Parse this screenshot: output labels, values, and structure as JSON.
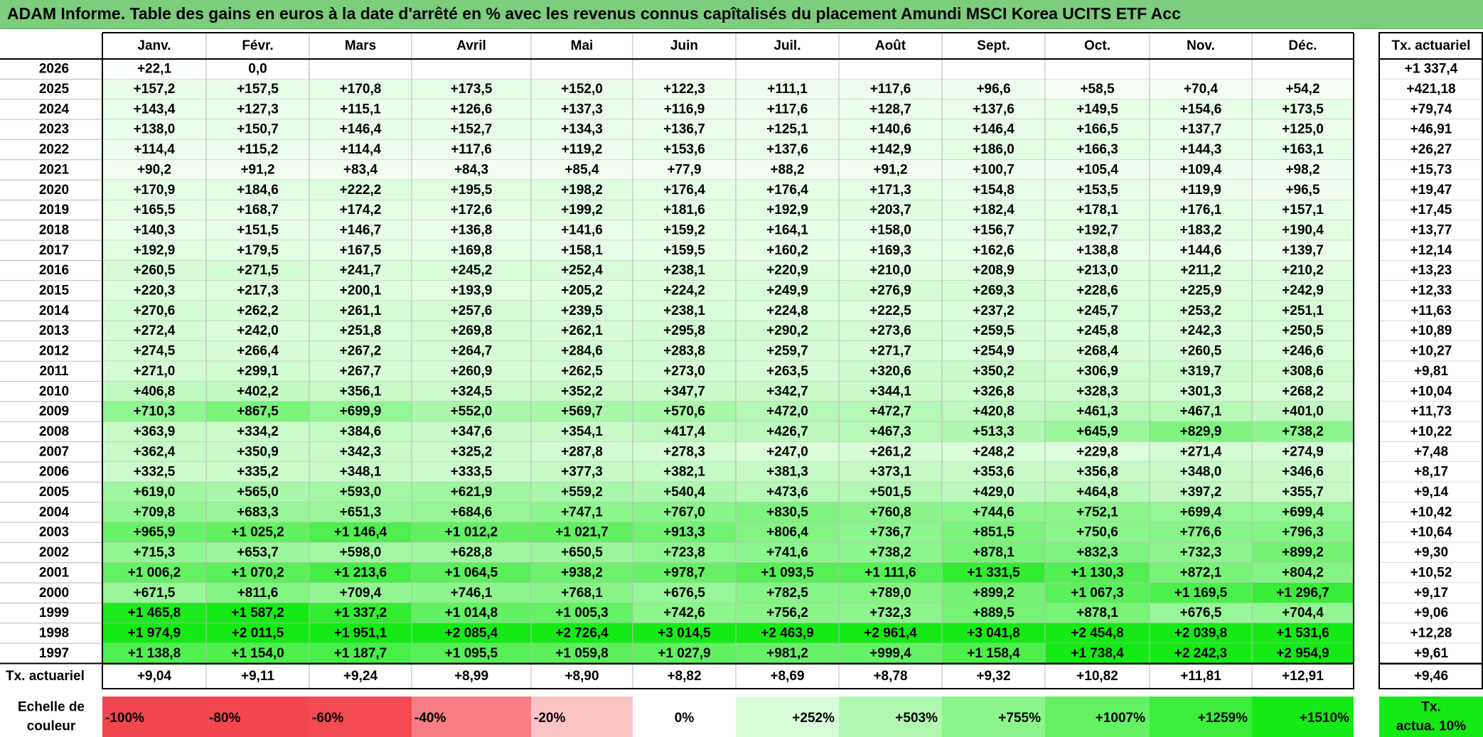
{
  "title": "ADAM Informe. Table des gains en euros à la date d'arrêté en % avec les revenus connus capîtalisés du placement Amundi MSCI Korea UCITS ETF Acc",
  "chart_data": {
    "type": "table",
    "months": [
      "Janv.",
      "Févr.",
      "Mars",
      "Avril",
      "Mai",
      "Juin",
      "Juil.",
      "Août",
      "Sept.",
      "Oct.",
      "Nov.",
      "Déc."
    ],
    "rate_header": "Tx. actuariel",
    "rows": [
      {
        "year": "2026",
        "values": [
          "+22,1",
          "0,0",
          "",
          "",
          "",
          "",
          "",
          "",
          "",
          "",
          "",
          ""
        ],
        "rate": "+1 337,4"
      },
      {
        "year": "2025",
        "values": [
          "+157,2",
          "+157,5",
          "+170,8",
          "+173,5",
          "+152,0",
          "+122,3",
          "+111,1",
          "+117,6",
          "+96,6",
          "+58,5",
          "+70,4",
          "+54,2"
        ],
        "rate": "+421,18"
      },
      {
        "year": "2024",
        "values": [
          "+143,4",
          "+127,3",
          "+115,1",
          "+126,6",
          "+137,3",
          "+116,9",
          "+117,6",
          "+128,7",
          "+137,6",
          "+149,5",
          "+154,6",
          "+173,5"
        ],
        "rate": "+79,74"
      },
      {
        "year": "2023",
        "values": [
          "+138,0",
          "+150,7",
          "+146,4",
          "+152,7",
          "+134,3",
          "+136,7",
          "+125,1",
          "+140,6",
          "+146,4",
          "+166,5",
          "+137,7",
          "+125,0"
        ],
        "rate": "+46,91"
      },
      {
        "year": "2022",
        "values": [
          "+114,4",
          "+115,2",
          "+114,4",
          "+117,6",
          "+119,2",
          "+153,6",
          "+137,6",
          "+142,9",
          "+186,0",
          "+166,3",
          "+144,3",
          "+163,1"
        ],
        "rate": "+26,27"
      },
      {
        "year": "2021",
        "values": [
          "+90,2",
          "+91,2",
          "+83,4",
          "+84,3",
          "+85,4",
          "+77,9",
          "+88,2",
          "+91,2",
          "+100,7",
          "+105,4",
          "+109,4",
          "+98,2"
        ],
        "rate": "+15,73"
      },
      {
        "year": "2020",
        "values": [
          "+170,9",
          "+184,6",
          "+222,2",
          "+195,5",
          "+198,2",
          "+176,4",
          "+176,4",
          "+171,3",
          "+154,8",
          "+153,5",
          "+119,9",
          "+96,5"
        ],
        "rate": "+19,47"
      },
      {
        "year": "2019",
        "values": [
          "+165,5",
          "+168,7",
          "+174,2",
          "+172,6",
          "+199,2",
          "+181,6",
          "+192,9",
          "+203,7",
          "+182,4",
          "+178,1",
          "+176,1",
          "+157,1"
        ],
        "rate": "+17,45"
      },
      {
        "year": "2018",
        "values": [
          "+140,3",
          "+151,5",
          "+146,7",
          "+136,8",
          "+141,6",
          "+159,2",
          "+164,1",
          "+158,0",
          "+156,7",
          "+192,7",
          "+183,2",
          "+190,4"
        ],
        "rate": "+13,77"
      },
      {
        "year": "2017",
        "values": [
          "+192,9",
          "+179,5",
          "+167,5",
          "+169,8",
          "+158,1",
          "+159,5",
          "+160,2",
          "+169,3",
          "+162,6",
          "+138,8",
          "+144,6",
          "+139,7"
        ],
        "rate": "+12,14"
      },
      {
        "year": "2016",
        "values": [
          "+260,5",
          "+271,5",
          "+241,7",
          "+245,2",
          "+252,4",
          "+238,1",
          "+220,9",
          "+210,0",
          "+208,9",
          "+213,0",
          "+211,2",
          "+210,2"
        ],
        "rate": "+13,23"
      },
      {
        "year": "2015",
        "values": [
          "+220,3",
          "+217,3",
          "+200,1",
          "+193,9",
          "+205,2",
          "+224,2",
          "+249,9",
          "+276,9",
          "+269,3",
          "+228,6",
          "+225,9",
          "+242,9"
        ],
        "rate": "+12,33"
      },
      {
        "year": "2014",
        "values": [
          "+270,6",
          "+262,2",
          "+261,1",
          "+257,6",
          "+239,5",
          "+238,1",
          "+224,8",
          "+222,5",
          "+237,2",
          "+245,7",
          "+253,2",
          "+251,1"
        ],
        "rate": "+11,63"
      },
      {
        "year": "2013",
        "values": [
          "+272,4",
          "+242,0",
          "+251,8",
          "+269,8",
          "+262,1",
          "+295,8",
          "+290,2",
          "+273,6",
          "+259,5",
          "+245,8",
          "+242,3",
          "+250,5"
        ],
        "rate": "+10,89"
      },
      {
        "year": "2012",
        "values": [
          "+274,5",
          "+266,4",
          "+267,2",
          "+264,7",
          "+284,6",
          "+283,8",
          "+259,7",
          "+271,7",
          "+254,9",
          "+268,4",
          "+260,5",
          "+246,6"
        ],
        "rate": "+10,27"
      },
      {
        "year": "2011",
        "values": [
          "+271,0",
          "+299,1",
          "+267,7",
          "+260,9",
          "+262,5",
          "+273,0",
          "+263,5",
          "+320,6",
          "+350,2",
          "+306,9",
          "+319,7",
          "+308,6"
        ],
        "rate": "+9,81"
      },
      {
        "year": "2010",
        "values": [
          "+406,8",
          "+402,2",
          "+356,1",
          "+324,5",
          "+352,2",
          "+347,7",
          "+342,7",
          "+344,1",
          "+326,8",
          "+328,3",
          "+301,3",
          "+268,2"
        ],
        "rate": "+10,04"
      },
      {
        "year": "2009",
        "values": [
          "+710,3",
          "+867,5",
          "+699,9",
          "+552,0",
          "+569,7",
          "+570,6",
          "+472,0",
          "+472,7",
          "+420,8",
          "+461,3",
          "+467,1",
          "+401,0"
        ],
        "rate": "+11,73"
      },
      {
        "year": "2008",
        "values": [
          "+363,9",
          "+334,2",
          "+384,6",
          "+347,6",
          "+354,1",
          "+417,4",
          "+426,7",
          "+467,3",
          "+513,3",
          "+645,9",
          "+829,9",
          "+738,2"
        ],
        "rate": "+10,22"
      },
      {
        "year": "2007",
        "values": [
          "+362,4",
          "+350,9",
          "+342,3",
          "+325,2",
          "+287,8",
          "+278,3",
          "+247,0",
          "+261,2",
          "+248,2",
          "+229,8",
          "+271,4",
          "+274,9"
        ],
        "rate": "+7,48"
      },
      {
        "year": "2006",
        "values": [
          "+332,5",
          "+335,2",
          "+348,1",
          "+333,5",
          "+377,3",
          "+382,1",
          "+381,3",
          "+373,1",
          "+353,6",
          "+356,8",
          "+348,0",
          "+346,6"
        ],
        "rate": "+8,17"
      },
      {
        "year": "2005",
        "values": [
          "+619,0",
          "+565,0",
          "+593,0",
          "+621,9",
          "+559,2",
          "+540,4",
          "+473,6",
          "+501,5",
          "+429,0",
          "+464,8",
          "+397,2",
          "+355,7"
        ],
        "rate": "+9,14"
      },
      {
        "year": "2004",
        "values": [
          "+709,8",
          "+683,3",
          "+651,3",
          "+684,6",
          "+747,1",
          "+767,0",
          "+830,5",
          "+760,8",
          "+744,6",
          "+752,1",
          "+699,4",
          "+699,4"
        ],
        "rate": "+10,42"
      },
      {
        "year": "2003",
        "values": [
          "+965,9",
          "+1 025,2",
          "+1 146,4",
          "+1 012,2",
          "+1 021,7",
          "+913,3",
          "+806,4",
          "+736,7",
          "+851,5",
          "+750,6",
          "+776,6",
          "+796,3"
        ],
        "rate": "+10,64"
      },
      {
        "year": "2002",
        "values": [
          "+715,3",
          "+653,7",
          "+598,0",
          "+628,8",
          "+650,5",
          "+723,8",
          "+741,6",
          "+738,2",
          "+878,1",
          "+832,3",
          "+732,3",
          "+899,2"
        ],
        "rate": "+9,30"
      },
      {
        "year": "2001",
        "values": [
          "+1 006,2",
          "+1 070,2",
          "+1 213,6",
          "+1 064,5",
          "+938,2",
          "+978,7",
          "+1 093,5",
          "+1 111,6",
          "+1 331,5",
          "+1 130,3",
          "+872,1",
          "+804,2"
        ],
        "rate": "+10,52"
      },
      {
        "year": "2000",
        "values": [
          "+671,5",
          "+811,6",
          "+709,4",
          "+746,1",
          "+768,1",
          "+676,5",
          "+782,5",
          "+789,0",
          "+899,2",
          "+1 067,3",
          "+1 169,5",
          "+1 296,7"
        ],
        "rate": "+9,17"
      },
      {
        "year": "1999",
        "values": [
          "+1 465,8",
          "+1 587,2",
          "+1 337,2",
          "+1 014,8",
          "+1 005,3",
          "+742,6",
          "+756,2",
          "+732,3",
          "+889,5",
          "+878,1",
          "+676,5",
          "+704,4"
        ],
        "rate": "+9,06"
      },
      {
        "year": "1998",
        "values": [
          "+1 974,9",
          "+2 011,5",
          "+1 951,1",
          "+2 085,4",
          "+2 726,4",
          "+3 014,5",
          "+2 463,9",
          "+2 961,4",
          "+3 041,8",
          "+2 454,8",
          "+2 039,8",
          "+1 531,6"
        ],
        "rate": "+12,28"
      },
      {
        "year": "1997",
        "values": [
          "+1 138,8",
          "+1 154,0",
          "+1 187,7",
          "+1 095,5",
          "+1 059,8",
          "+1 027,9",
          "+981,2",
          "+999,4",
          "+1 158,4",
          "+1 738,4",
          "+2 242,3",
          "+2 954,9"
        ],
        "rate": "+9,61"
      }
    ],
    "footer": {
      "label": "Tx. actuariel",
      "values": [
        "+9,04",
        "+9,11",
        "+9,24",
        "+8,99",
        "+8,90",
        "+8,82",
        "+8,69",
        "+8,78",
        "+9,32",
        "+10,82",
        "+11,81",
        "+12,91"
      ],
      "rate": "+9,46"
    },
    "scale": {
      "label_line1": "Echelle de",
      "label_line2": "couleur",
      "steps": [
        {
          "text": "-100%",
          "color": "#f0474e",
          "align": "left"
        },
        {
          "text": "-80%",
          "color": "#f2474e",
          "align": "left"
        },
        {
          "text": "-60%",
          "color": "#f44a51",
          "align": "left"
        },
        {
          "text": "-40%",
          "color": "#f77e84",
          "align": "left"
        },
        {
          "text": "-20%",
          "color": "#fcc3c6",
          "align": "left"
        },
        {
          "text": "0%",
          "color": "#ffffff",
          "align": "center"
        },
        {
          "text": "+252%",
          "color": "#d8fcd8",
          "align": "right"
        },
        {
          "text": "+503%",
          "color": "#b1f8b1",
          "align": "right"
        },
        {
          "text": "+755%",
          "color": "#8bf58b",
          "align": "right"
        },
        {
          "text": "+1007%",
          "color": "#64f164",
          "align": "right"
        },
        {
          "text": "+1259%",
          "color": "#3dee3d",
          "align": "right"
        },
        {
          "text": "+1510%",
          "color": "#16ea16",
          "align": "right"
        }
      ],
      "rate_line1": "Tx.",
      "rate_line2": "actua. 10%",
      "rate_color": "#16ea16"
    }
  }
}
